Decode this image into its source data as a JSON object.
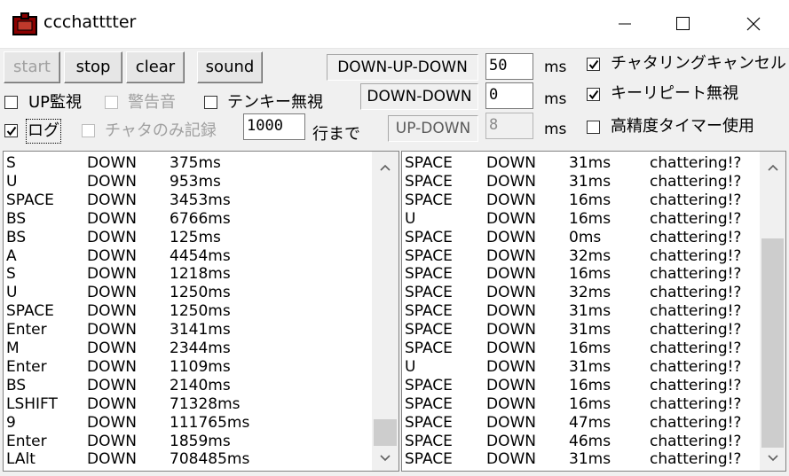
{
  "window": {
    "title": "ccchatttter"
  },
  "toolbar": {
    "start": "start",
    "stop": "stop",
    "clear": "clear",
    "sound": "sound"
  },
  "checks": {
    "up_monitor": "UP監視",
    "warning_sound": "警告音",
    "tenkey_ignore": "テンキー無視",
    "log": "ログ",
    "chatter_only": "チャタのみ記録",
    "lines_until": "行まで",
    "chatter_cancel": "チャタリングキャンセル",
    "key_repeat_ignore": "キーリピート無視",
    "hires_timer": "高精度タイマー使用"
  },
  "log_lines_value": "1000",
  "modes": [
    {
      "parts": [
        "DOWN",
        "UP",
        "DOWN"
      ],
      "value": "50",
      "unit": "ms"
    },
    {
      "parts": [
        "DOWN",
        "DOWN"
      ],
      "value": "0",
      "unit": "ms"
    },
    {
      "parts": [
        "UP",
        "DOWN"
      ],
      "value": "8",
      "unit": "ms"
    }
  ],
  "left_rows": [
    [
      "S",
      "DOWN",
      "375ms"
    ],
    [
      "U",
      "DOWN",
      "953ms"
    ],
    [
      "SPACE",
      "DOWN",
      "3453ms"
    ],
    [
      "BS",
      "DOWN",
      "6766ms"
    ],
    [
      "BS",
      "DOWN",
      "125ms"
    ],
    [
      "A",
      "DOWN",
      "4454ms"
    ],
    [
      "S",
      "DOWN",
      "1218ms"
    ],
    [
      "U",
      "DOWN",
      "1250ms"
    ],
    [
      "SPACE",
      "DOWN",
      "1250ms"
    ],
    [
      "Enter",
      "DOWN",
      "3141ms"
    ],
    [
      "M",
      "DOWN",
      "2344ms"
    ],
    [
      "Enter",
      "DOWN",
      "1109ms"
    ],
    [
      "BS",
      "DOWN",
      "2140ms"
    ],
    [
      "LSHIFT",
      "DOWN",
      "71328ms"
    ],
    [
      "9",
      "DOWN",
      "111765ms"
    ],
    [
      "Enter",
      "DOWN",
      "1859ms"
    ],
    [
      "LAlt",
      "DOWN",
      "708485ms"
    ]
  ],
  "right_rows": [
    [
      "SPACE",
      "DOWN",
      "31ms",
      "chattering!?"
    ],
    [
      "SPACE",
      "DOWN",
      "31ms",
      "chattering!?"
    ],
    [
      "SPACE",
      "DOWN",
      "16ms",
      "chattering!?"
    ],
    [
      "U",
      "DOWN",
      "16ms",
      "chattering!?"
    ],
    [
      "SPACE",
      "DOWN",
      "0ms",
      "chattering!?"
    ],
    [
      "SPACE",
      "DOWN",
      "32ms",
      "chattering!?"
    ],
    [
      "SPACE",
      "DOWN",
      "16ms",
      "chattering!?"
    ],
    [
      "SPACE",
      "DOWN",
      "32ms",
      "chattering!?"
    ],
    [
      "SPACE",
      "DOWN",
      "31ms",
      "chattering!?"
    ],
    [
      "SPACE",
      "DOWN",
      "31ms",
      "chattering!?"
    ],
    [
      "SPACE",
      "DOWN",
      "16ms",
      "chattering!?"
    ],
    [
      "U",
      "DOWN",
      "31ms",
      "chattering!?"
    ],
    [
      "SPACE",
      "DOWN",
      "16ms",
      "chattering!?"
    ],
    [
      "SPACE",
      "DOWN",
      "16ms",
      "chattering!?"
    ],
    [
      "SPACE",
      "DOWN",
      "47ms",
      "chattering!?"
    ],
    [
      "SPACE",
      "DOWN",
      "46ms",
      "chattering!?"
    ],
    [
      "SPACE",
      "DOWN",
      "31ms",
      "chattering!?"
    ]
  ],
  "state": {
    "up_monitor": false,
    "warning_sound": false,
    "tenkey_ignore": false,
    "log": true,
    "chatter_only": false,
    "chatter_cancel": true,
    "key_repeat_ignore": true,
    "hires_timer": false
  }
}
